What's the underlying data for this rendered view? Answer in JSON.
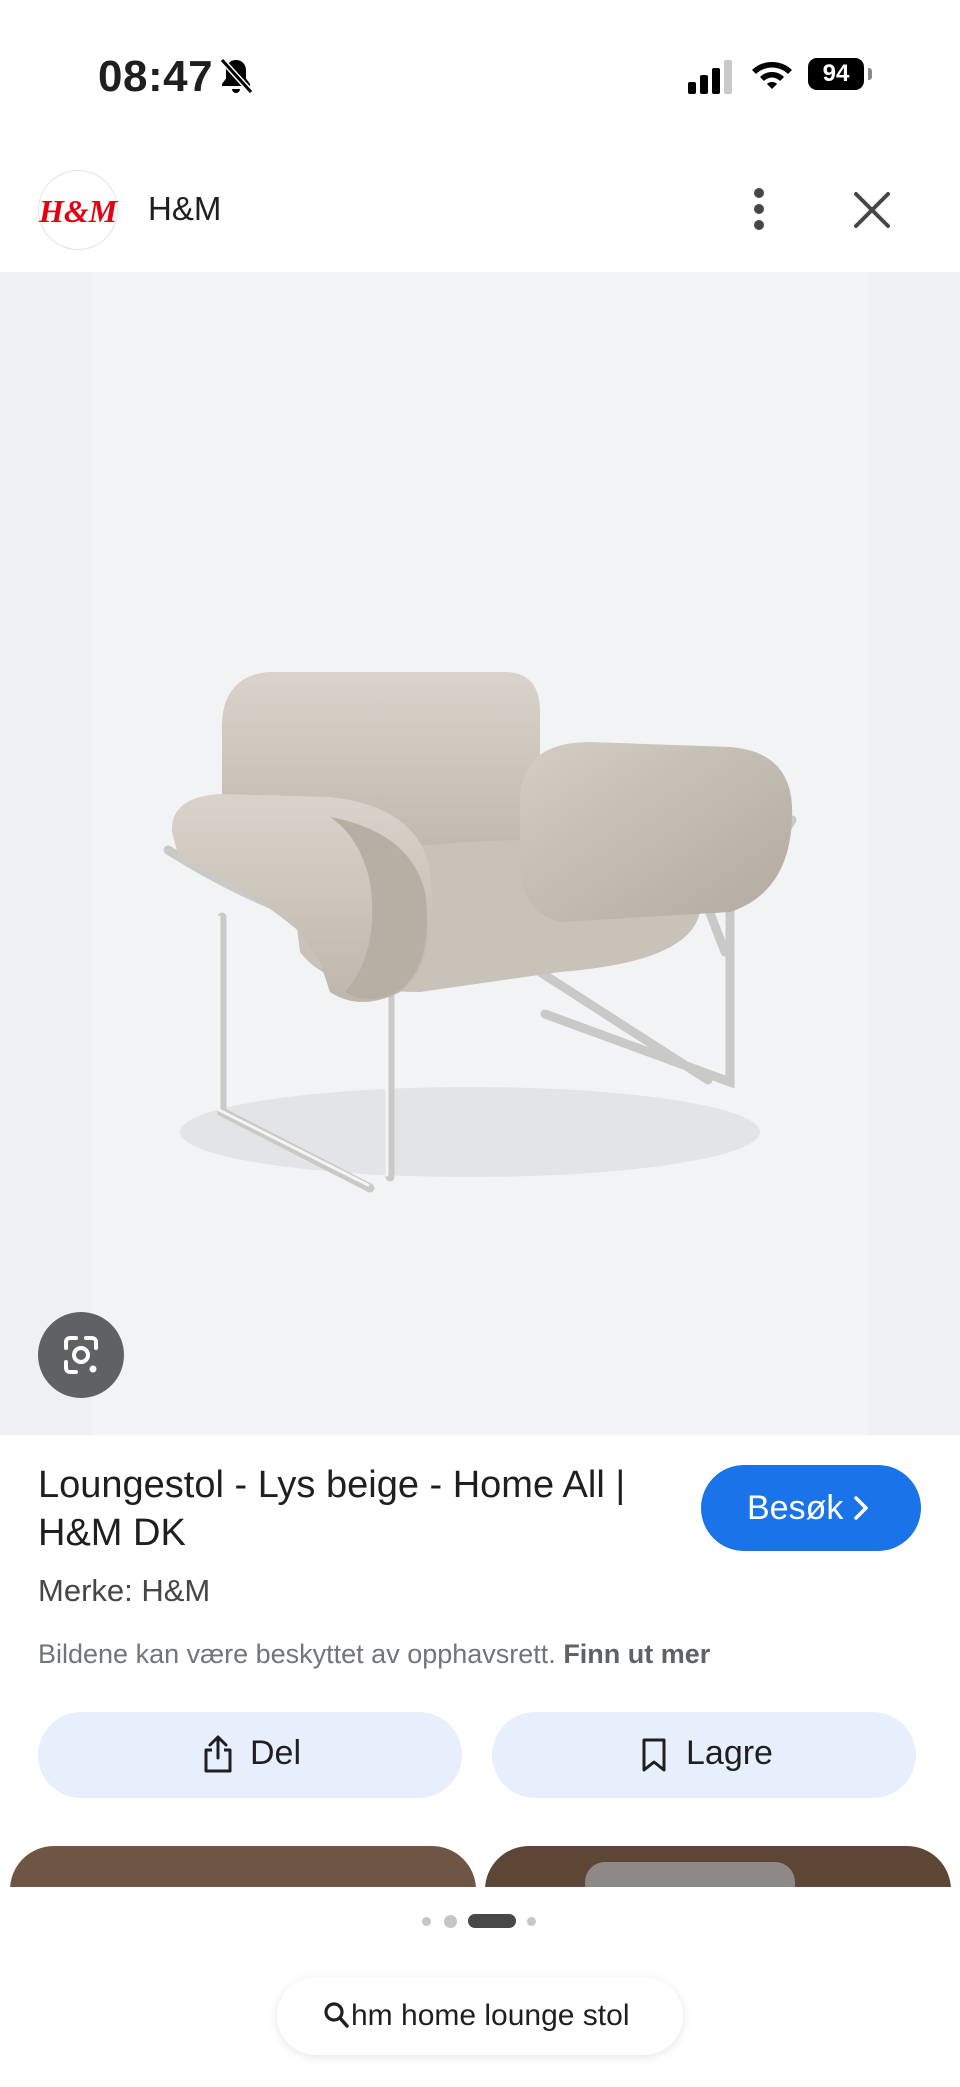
{
  "status_bar": {
    "time": "08:47",
    "battery": "94",
    "icons": [
      "bell-muted-icon",
      "cellular-signal-icon",
      "wifi-icon",
      "battery-icon"
    ]
  },
  "header": {
    "logo_text": "H&M",
    "site_name": "H&M",
    "icons": [
      "more-vertical-icon",
      "close-icon"
    ]
  },
  "image": {
    "subject": "lounge chair",
    "lens_icon": "google-lens-icon"
  },
  "result": {
    "title": "Loungestol - Lys beige - Home All | H&M DK",
    "visit_label": "Besøk",
    "brand": "Merke: H&M",
    "copyright_text": "Bildene kan være beskyttet av opphavsrett.",
    "learn_more": "Finn ut mer"
  },
  "actions": {
    "share_label": "Del",
    "save_label": "Lagre"
  },
  "pager": {
    "count": 4,
    "active_index": 2
  },
  "search": {
    "query": "hm home lounge stol"
  },
  "colors": {
    "accent": "#1a73e8",
    "action_pill": "#e7effc",
    "brand_red": "#e50010"
  }
}
